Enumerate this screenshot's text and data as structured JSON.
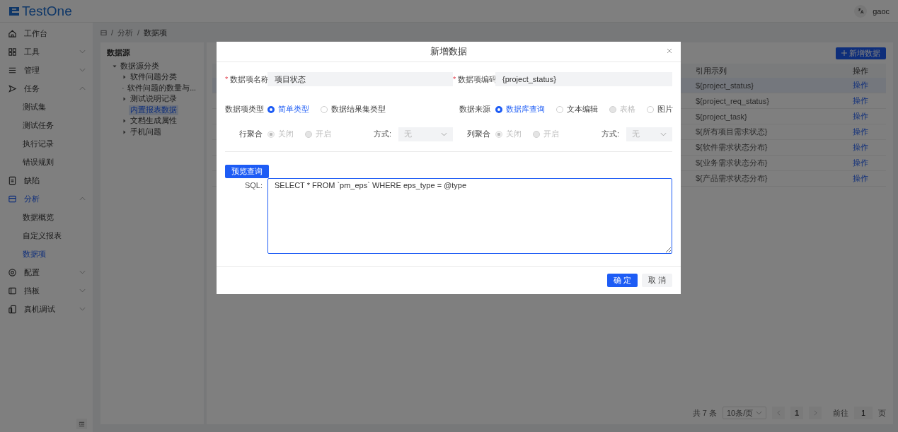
{
  "header": {
    "logo": "TestOne",
    "user": "gaoc"
  },
  "sidebar": {
    "items": [
      {
        "label": "工作台",
        "selected": false
      },
      {
        "label": "工具",
        "selected": false,
        "expanded": false
      },
      {
        "label": "管理",
        "selected": false,
        "expanded": false
      },
      {
        "label": "任务",
        "selected": false,
        "expanded": true,
        "children": [
          {
            "label": "测试集",
            "selected": false
          },
          {
            "label": "测试任务",
            "selected": false
          },
          {
            "label": "执行记录",
            "selected": false
          },
          {
            "label": "错误规则",
            "selected": false
          }
        ]
      },
      {
        "label": "缺陷",
        "selected": false
      },
      {
        "label": "分析",
        "selected": true,
        "expanded": true,
        "children": [
          {
            "label": "数据概览",
            "selected": false
          },
          {
            "label": "自定义报表",
            "selected": false
          },
          {
            "label": "数据项",
            "selected": true
          }
        ]
      },
      {
        "label": "配置",
        "selected": false,
        "expanded": false
      },
      {
        "label": "挡板",
        "selected": false,
        "expanded": false
      },
      {
        "label": "真机调试",
        "selected": false,
        "expanded": false
      }
    ]
  },
  "breadcrumb": {
    "separator": "/",
    "items": [
      "分析",
      "数据项"
    ]
  },
  "tree": {
    "title": "数据源",
    "items": [
      {
        "label": "数据源分类",
        "expanded": true,
        "selected": false,
        "children": [
          {
            "label": "软件问题分类",
            "expanded": false,
            "selected": false
          },
          {
            "label": "软件问题的数量与...",
            "expanded": false,
            "selected": false
          },
          {
            "label": "测试说明记录",
            "expanded": false,
            "selected": false
          },
          {
            "label": "内置报表数据",
            "selected": true
          },
          {
            "label": "文档生成属性",
            "expanded": false,
            "selected": false
          },
          {
            "label": "手机问题",
            "expanded": false,
            "selected": false
          }
        ]
      }
    ]
  },
  "table_panel": {
    "add_button": "新增数据",
    "columns": [
      "引用示列",
      "操作"
    ],
    "rows": [
      {
        "example": "${project_status}",
        "action": "操作",
        "selected": true
      },
      {
        "example": "${project_req_status}",
        "action": "操作",
        "selected": false
      },
      {
        "example": "${project_task}",
        "action": "操作",
        "selected": false
      },
      {
        "example": "${所有项目需求状态}",
        "action": "操作",
        "selected": false
      },
      {
        "example": "${软件需求状态分布}",
        "action": "操作",
        "selected": false
      },
      {
        "example": "${业务需求状态分布}",
        "action": "操作",
        "selected": false
      },
      {
        "example": "${产品需求状态分布}",
        "action": "操作",
        "selected": false
      }
    ],
    "pagination": {
      "total": "共 7 条",
      "page_size": "10条/页",
      "page": "1",
      "goto_label": "前往",
      "goto_value": "1",
      "goto_unit": "页"
    }
  },
  "dialog": {
    "title": "新增数据",
    "fields": [
      {
        "label": "数据项名称",
        "required_mark": "*",
        "value": "项目状态"
      },
      {
        "label": "数据项编码",
        "required_mark": "*",
        "value": "{project_status}"
      }
    ],
    "radio_rows": [
      {
        "groups": [
          {
            "label": "数据项类型",
            "options": [
              {
                "label": "简单类型",
                "selected": true,
                "disabled": false
              },
              {
                "label": "数据结果集类型",
                "selected": false,
                "disabled": false
              }
            ]
          },
          {
            "label": "数据来源",
            "options": [
              {
                "label": "数据库查询",
                "selected": true,
                "disabled": false
              },
              {
                "label": "文本编辑",
                "selected": false,
                "disabled": false
              },
              {
                "label": "表格",
                "selected": false,
                "disabled": true
              },
              {
                "label": "图片",
                "selected": false,
                "disabled": false
              }
            ]
          }
        ]
      },
      {
        "groups": [
          {
            "label": "行聚合",
            "options": [
              {
                "label": "关闭",
                "selected": true,
                "disabled": true
              },
              {
                "label": "开启",
                "selected": false,
                "disabled": true
              }
            ],
            "select": {
              "label": "方式:",
              "placeholder": "无",
              "disabled": true
            }
          },
          {
            "label": "列聚合",
            "options": [
              {
                "label": "关闭",
                "selected": true,
                "disabled": true
              },
              {
                "label": "开启",
                "selected": false,
                "disabled": true
              }
            ],
            "select": {
              "label": "方式:",
              "placeholder": "无",
              "disabled": true
            }
          }
        ]
      }
    ],
    "preview_button": "预览查询",
    "sql_label": "SQL:",
    "sql": "SELECT * FROM `pm_eps` WHERE eps_type = @type",
    "buttons": [
      {
        "label": "确 定",
        "kind": "primary"
      },
      {
        "label": "取 消",
        "kind": "default"
      }
    ]
  }
}
